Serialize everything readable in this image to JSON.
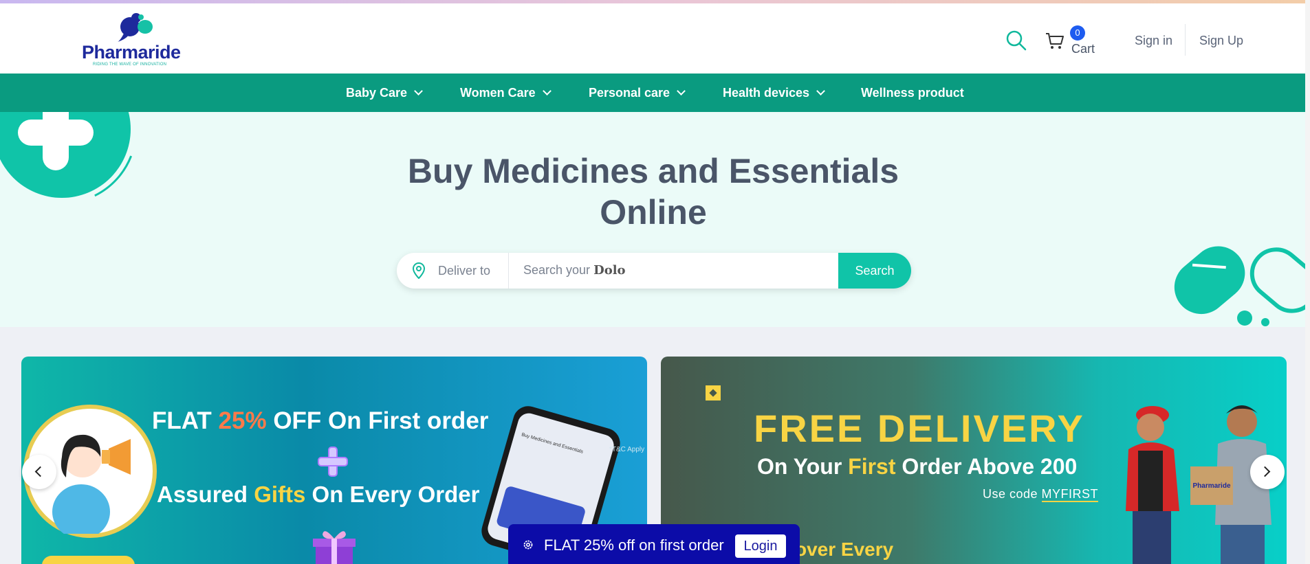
{
  "header": {
    "logo_text": "Pharmaride",
    "logo_tagline": "RIDING THE WAVE OF INNOVATION",
    "cart_count": "0",
    "cart_label": "Cart",
    "sign_in": "Sign in",
    "sign_up": "Sign Up",
    "icons": [
      "search-icon",
      "cart-icon"
    ]
  },
  "nav": {
    "items": [
      {
        "label": "Baby Care",
        "has_dropdown": true
      },
      {
        "label": "Women Care",
        "has_dropdown": true
      },
      {
        "label": "Personal care",
        "has_dropdown": true
      },
      {
        "label": "Health devices",
        "has_dropdown": true
      },
      {
        "label": "Wellness product",
        "has_dropdown": false
      }
    ]
  },
  "hero": {
    "title_line1": "Buy Medicines and Essentials",
    "title_line2": "Online",
    "deliver_placeholder": "Deliver to",
    "search_placeholder_prefix": "Search your",
    "search_placeholder_word": "Dolo",
    "search_button": "Search"
  },
  "banner1": {
    "line1_a": "FLAT ",
    "line1_accent": "25%",
    "line1_b": " OFF On First order",
    "line2_a": "Assured ",
    "line2_accent": "Gifts",
    "line2_b": " On Every Order",
    "tnc": "*T&C Apply",
    "phone_title": "Buy Medicines and Essentials"
  },
  "banner2": {
    "headline": "FREE DELIVERY",
    "sub_a": "On Your ",
    "sub_accent": "First",
    "sub_b": " Order Above 200",
    "code_prefix": "Use code ",
    "code": "MYFIRST",
    "bottom_text": "over Every"
  },
  "promo": {
    "text": "FLAT 25% off on first order",
    "login": "Login"
  },
  "colors": {
    "nav_bg": "#0a9b80",
    "accent": "#10c4a8",
    "logo_blue": "#1e2a9c",
    "promo_bg": "#0c0ca8",
    "yellow": "#f8d444"
  }
}
